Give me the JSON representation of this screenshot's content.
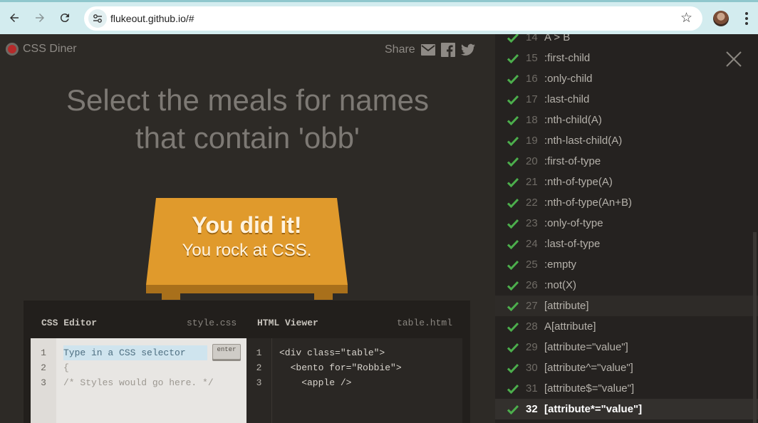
{
  "browser": {
    "url": "flukeout.github.io/#",
    "back_icon": "arrow-left-icon",
    "forward_icon": "arrow-right-icon",
    "reload_icon": "reload-icon",
    "star_icon": "star-icon",
    "menu_icon": "kebab-menu-icon"
  },
  "header": {
    "logo_text": "CSS Diner",
    "share_label": "Share"
  },
  "title": {
    "line1": "Select the meals for names",
    "line2": "that contain 'obb'"
  },
  "table": {
    "line1": "You did it!",
    "line2": "You rock at CSS."
  },
  "css_editor": {
    "label": "CSS Editor",
    "file": "style.css",
    "placeholder": "Type in a CSS selector",
    "enter_label": "enter",
    "line_numbers": [
      "1",
      "2",
      "3"
    ],
    "line2": "{",
    "line3": "/* Styles would go here. */"
  },
  "html_viewer": {
    "label": "HTML Viewer",
    "file": "table.html",
    "line_numbers": [
      "1",
      "2",
      "3"
    ],
    "lines": [
      "<div class=\"table\">",
      "  <bento for=\"Robbie\">",
      "    <apple />"
    ]
  },
  "levels": [
    {
      "num": "14",
      "name": "A > B"
    },
    {
      "num": "15",
      "name": ":first-child"
    },
    {
      "num": "16",
      "name": ":only-child"
    },
    {
      "num": "17",
      "name": ":last-child"
    },
    {
      "num": "18",
      "name": ":nth-child(A)"
    },
    {
      "num": "19",
      "name": ":nth-last-child(A)"
    },
    {
      "num": "20",
      "name": ":first-of-type"
    },
    {
      "num": "21",
      "name": ":nth-of-type(A)"
    },
    {
      "num": "22",
      "name": ":nth-of-type(An+B)"
    },
    {
      "num": "23",
      "name": ":only-of-type"
    },
    {
      "num": "24",
      "name": ":last-of-type"
    },
    {
      "num": "25",
      "name": ":empty"
    },
    {
      "num": "26",
      "name": ":not(X)"
    },
    {
      "num": "27",
      "name": "[attribute]"
    },
    {
      "num": "28",
      "name": "A[attribute]"
    },
    {
      "num": "29",
      "name": "[attribute=\"value\"]"
    },
    {
      "num": "30",
      "name": "[attribute^=\"value\"]"
    },
    {
      "num": "31",
      "name": "[attribute$=\"value\"]"
    },
    {
      "num": "32",
      "name": "[attribute*=\"value\"]"
    }
  ],
  "colors": {
    "check": "#4cae4c",
    "table": "#e09a2c",
    "accent_red": "#b52a2a"
  }
}
